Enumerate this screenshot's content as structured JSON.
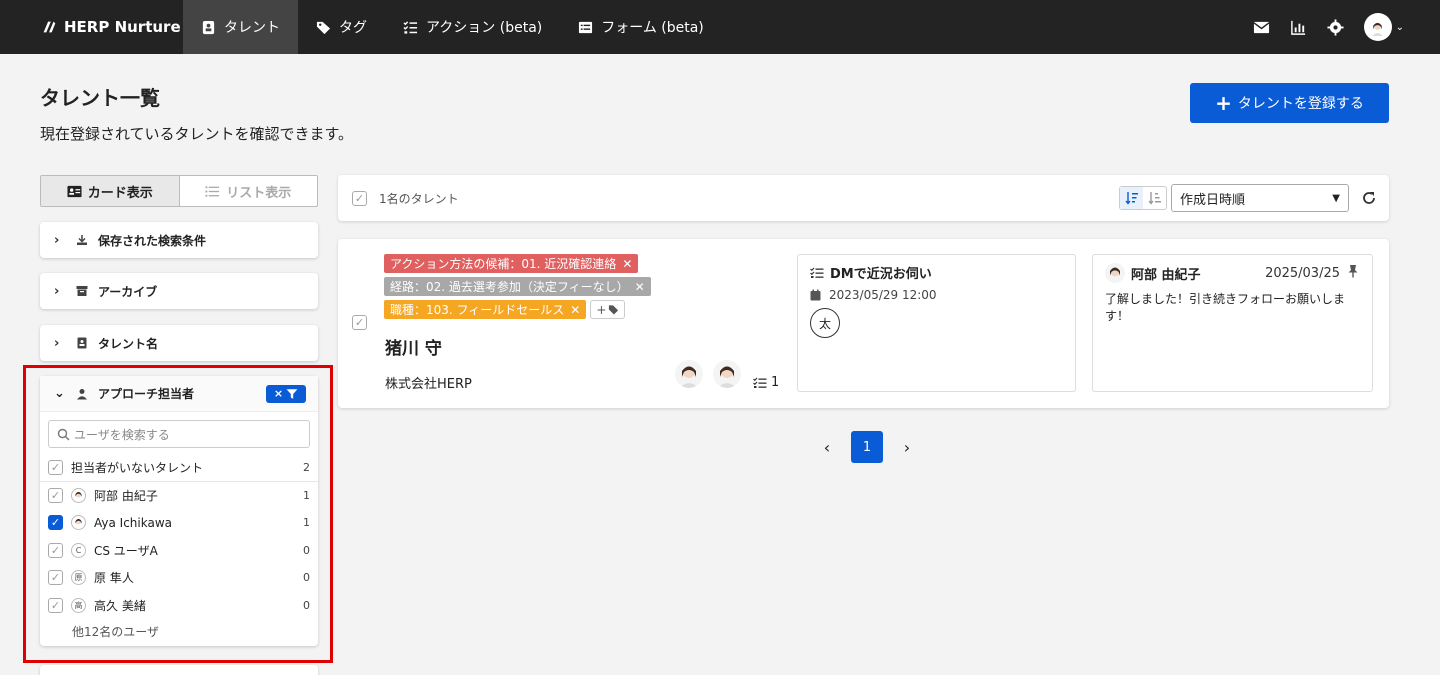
{
  "nav": {
    "brand": "HERP Nurture",
    "items": [
      {
        "label": "タレント",
        "icon": "badge-icon",
        "active": true
      },
      {
        "label": "タグ",
        "icon": "tag-icon",
        "active": false
      },
      {
        "label": "アクション (beta)",
        "icon": "checklist-icon",
        "active": false
      },
      {
        "label": "フォーム (beta)",
        "icon": "form-icon",
        "active": false
      }
    ]
  },
  "page": {
    "title": "タレント一覧",
    "subtitle": "現在登録されているタレントを確認できます。",
    "register_button": "タレントを登録する"
  },
  "view_toggle": {
    "card": "カード表示",
    "list": "リスト表示"
  },
  "filters": {
    "saved": "保存された検索条件",
    "archive": "アーカイブ",
    "talent_name": "タレント名",
    "approach": {
      "title": "アプローチ担当者",
      "search_placeholder": "ユーザを検索する",
      "no_owner": {
        "label": "担当者がいないタレント",
        "count": "2"
      },
      "users": [
        {
          "name": "阿部 由紀子",
          "count": "1",
          "checked": false,
          "avatar": "photo"
        },
        {
          "name": "Aya Ichikawa",
          "count": "1",
          "checked": true,
          "avatar": "photo"
        },
        {
          "name": "CS ユーザA",
          "count": "0",
          "checked": false,
          "avatar": "C"
        },
        {
          "name": "原 隼人",
          "count": "0",
          "checked": false,
          "avatar": "原"
        },
        {
          "name": "高久 美緒",
          "count": "0",
          "checked": false,
          "avatar": "高"
        }
      ],
      "more": "他12名のユーザ"
    }
  },
  "results": {
    "count_label": "1名のタレント",
    "sort_value": "作成日時順"
  },
  "talent": {
    "tags": [
      {
        "label": "アクション方法の候補：01. 近況確認連絡",
        "color": "#e06060"
      },
      {
        "label": "経路：02. 過去選考参加（決定フィーなし）",
        "color": "#a8a8a8"
      },
      {
        "label": "職種：103. フィールドセールス",
        "color": "#f5a623"
      }
    ],
    "tag_add": "+",
    "name": "猪川 守",
    "company": "株式会社HERP",
    "action_count": "1",
    "action": {
      "title": "DMで近況お伺い",
      "datetime": "2023/05/29 12:00",
      "owner_initial": "太"
    },
    "memo": {
      "author": "阿部 由紀子",
      "date": "2025/03/25",
      "text": "了解しました！引き続きフォローお願いします！"
    }
  },
  "pagination": {
    "current": "1"
  }
}
